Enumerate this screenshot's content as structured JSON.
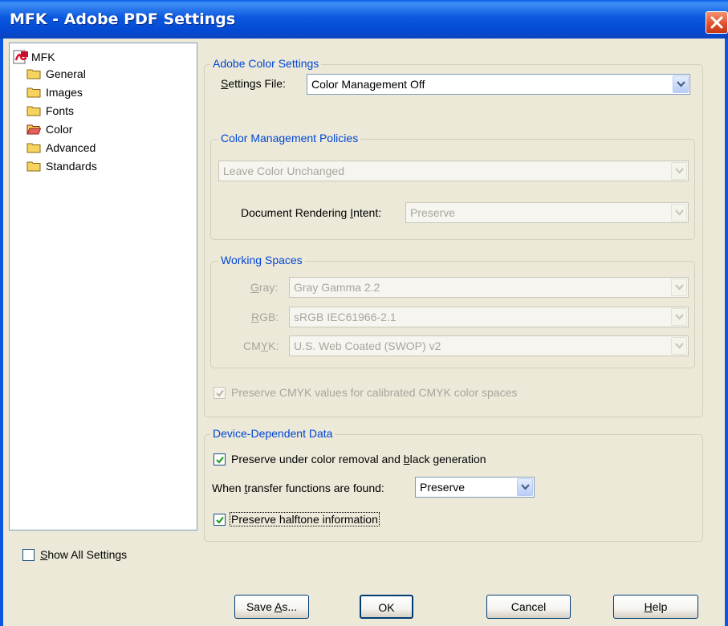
{
  "window": {
    "title": "MFK - Adobe PDF Settings"
  },
  "tree": {
    "root": "MFK",
    "items": [
      {
        "label": "General",
        "icon": "folder-icon"
      },
      {
        "label": "Images",
        "icon": "folder-icon"
      },
      {
        "label": "Fonts",
        "icon": "folder-icon"
      },
      {
        "label": "Color",
        "icon": "folder-open-icon"
      },
      {
        "label": "Advanced",
        "icon": "folder-icon"
      },
      {
        "label": "Standards",
        "icon": "folder-icon"
      }
    ]
  },
  "show_all": {
    "pre": "",
    "accel": "S",
    "post": "how All Settings",
    "checked": false
  },
  "color_settings": {
    "legend": "Adobe Color Settings",
    "settings_file_pre": "",
    "settings_file_accel": "S",
    "settings_file_post": "ettings File:",
    "settings_file_value": "Color Management Off"
  },
  "policies": {
    "legend": "Color Management Policies",
    "policy_value": "Leave Color Unchanged",
    "intent_pre": "Document Rendering ",
    "intent_accel": "I",
    "intent_post": "ntent:",
    "intent_value": "Preserve"
  },
  "working_spaces": {
    "legend": "Working Spaces",
    "gray": {
      "pre": "",
      "accel": "G",
      "post": "ray:",
      "value": "Gray Gamma 2.2"
    },
    "rgb": {
      "pre": "",
      "accel": "R",
      "post": "GB:",
      "value": "sRGB IEC61966-2.1"
    },
    "cmyk": {
      "pre": "CM",
      "accel": "Y",
      "post": "K:",
      "value": "U.S. Web Coated (SWOP) v2"
    }
  },
  "preserve_cmyk": {
    "label": "Preserve CMYK values for calibrated CMYK color spaces",
    "checked": true
  },
  "device_data": {
    "legend": "Device-Dependent Data",
    "ucr_pre": "Preserve under color removal and ",
    "ucr_accel": "b",
    "ucr_post": "lack generation",
    "ucr_checked": true,
    "transfer_pre": "When ",
    "transfer_accel": "t",
    "transfer_post": "ransfer functions are found:",
    "transfer_value": "Preserve",
    "halftone_label": "Preserve halftone information",
    "halftone_checked": true
  },
  "buttons": {
    "save_as_pre": "Save ",
    "save_as_accel": "A",
    "save_as_post": "s...",
    "ok": "OK",
    "cancel": "Cancel",
    "help_accel": "H",
    "help_post": "elp"
  },
  "colors": {
    "titlebar": "#0b58df",
    "legend_text": "#0046d5",
    "dialog_bg": "#ece9d8",
    "check_green": "#21a121"
  }
}
